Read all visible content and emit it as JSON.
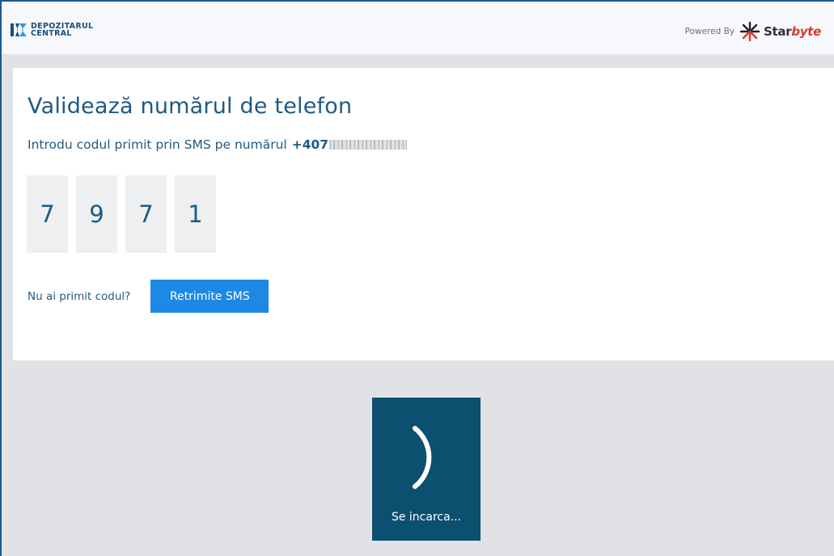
{
  "header": {
    "logo_line1": "DEPOZITARUL",
    "logo_line2": "CENTRAL",
    "powered_by": "Powered By",
    "brand_star": "Star",
    "brand_byte": "byte",
    "logo_icon": "depozitarul-logo-icon",
    "starbyte_icon": "starbyte-logo-icon"
  },
  "page": {
    "title": "Validează numărul de telefon",
    "subtitle": "Introdu codul primit prin SMS pe numărul",
    "phone_prefix": "+407"
  },
  "code": {
    "digits": [
      "7",
      "9",
      "7",
      "1"
    ]
  },
  "resend": {
    "question": "Nu ai primit codul?",
    "button_label": "Retrimite SMS"
  },
  "loader": {
    "label": "Se incarca..."
  },
  "colors": {
    "primary": "#1f5a82",
    "button": "#1e88e5",
    "loader_bg": "#0c5070",
    "accent_red": "#d9382d"
  }
}
